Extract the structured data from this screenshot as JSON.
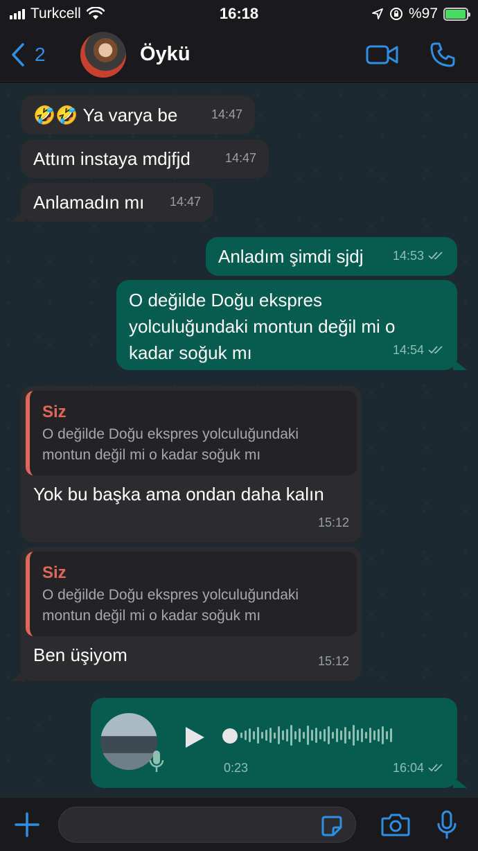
{
  "status_bar": {
    "carrier": "Turkcell",
    "time": "16:18",
    "battery": "%97"
  },
  "header": {
    "back_count": "2",
    "contact_name": "Öykü"
  },
  "messages": [
    {
      "direction": "in",
      "text": "🤣🤣 Ya varya be",
      "time": "14:47"
    },
    {
      "direction": "in",
      "text": "Attım instaya mdjfjd",
      "time": "14:47"
    },
    {
      "direction": "in",
      "text": "Anlamadın mı",
      "time": "14:47"
    },
    {
      "direction": "out",
      "text": "Anladım şimdi sjdj",
      "time": "14:53"
    },
    {
      "direction": "out",
      "text": "O değilde Doğu ekspres yolculuğundaki montun değil mi o kadar soğuk mı",
      "time": "14:54"
    },
    {
      "direction": "in",
      "quote_author": "Siz",
      "quote_text": "O değilde Doğu ekspres yolculuğundaki montun değil mi o kadar soğuk mı",
      "text": "Yok bu başka ama ondan daha kalın",
      "time": "15:12"
    },
    {
      "direction": "in",
      "quote_author": "Siz",
      "quote_text": "O değilde Doğu ekspres yolculuğundaki montun değil mi o kadar soğuk mı",
      "text": "Ben üşiyom",
      "time": "15:12"
    },
    {
      "direction": "out",
      "type": "voice",
      "duration": "0:23",
      "time": "16:04",
      "progress": 0
    }
  ],
  "input": {
    "placeholder": ""
  },
  "colors": {
    "accent": "#2f8fe6",
    "outgoing": "#065c4e",
    "incoming": "#2c2c2e",
    "quote_author": "#e0675a"
  }
}
